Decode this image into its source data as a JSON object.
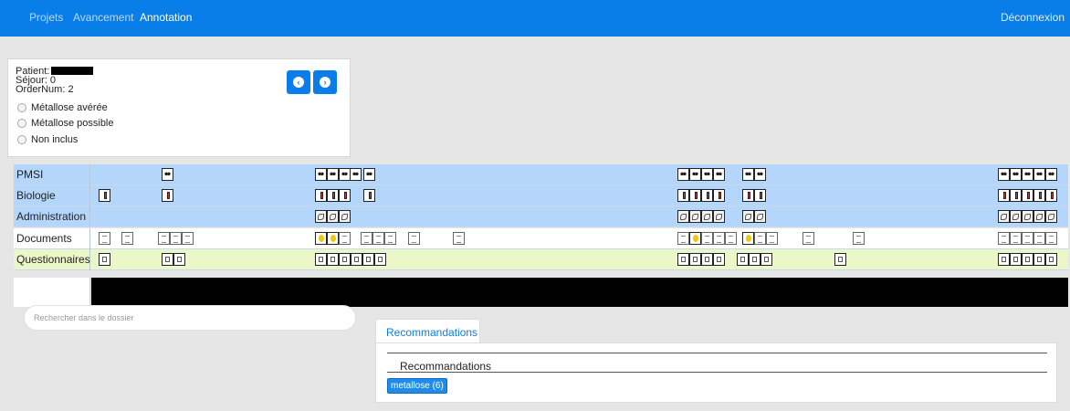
{
  "nav": {
    "items": [
      {
        "label": "Projets",
        "active": false
      },
      {
        "label": "Avancement",
        "active": false
      },
      {
        "label": "Annotation",
        "active": true
      }
    ],
    "logout": "Déconnexion"
  },
  "patient": {
    "patient_label": "Patient:",
    "sejour": "Séjour: 0",
    "ordernum": "OrderNum: 2",
    "options": [
      "Métallose avérée",
      "Métallose possible",
      "Non inclus"
    ],
    "prev_icon": "chevron-left-circle-icon",
    "next_icon": "chevron-right-circle-icon"
  },
  "timeline": {
    "rows": [
      {
        "label": "PMSI",
        "kind": "pmsi"
      },
      {
        "label": "Biologie",
        "kind": "bio"
      },
      {
        "label": "Administration",
        "kind": "admin"
      },
      {
        "label": "Documents",
        "kind": "doc"
      },
      {
        "label": "Questionnaires",
        "kind": "quest"
      }
    ]
  },
  "search": {
    "placeholder": "Rechercher dans le dossier"
  },
  "recommendations": {
    "tab_label": "Recommandations",
    "section_title": "Recommandations",
    "badge": "metallose (6)"
  },
  "colors": {
    "accent": "#0a7ee8",
    "row_blue": "#b5d6fb",
    "row_green": "#ecf7c9"
  }
}
